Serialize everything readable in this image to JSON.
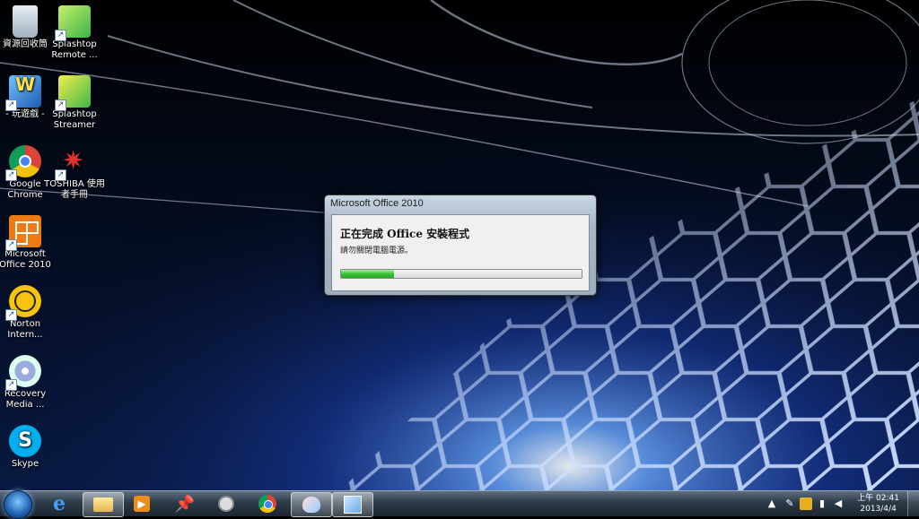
{
  "desktop": {
    "icons": [
      {
        "label": "資源回收筒",
        "icon": "recycle-bin-icon"
      },
      {
        "label": "Splashtop Remote ...",
        "icon": "splashtop-remote-icon"
      },
      {
        "label": "- 玩遊戲 -",
        "icon": "games-icon",
        "badge": "Games"
      },
      {
        "label": "Splashtop Streamer",
        "icon": "splashtop-streamer-icon"
      },
      {
        "label": "Google Chrome",
        "icon": "chrome-icon"
      },
      {
        "label": "TOSHIBA 使用者手冊",
        "icon": "toshiba-manual-icon"
      },
      {
        "label": "Microsoft Office 2010",
        "icon": "office-icon"
      },
      {
        "label": "Norton Intern...",
        "icon": "norton-icon"
      },
      {
        "label": "Recovery Media ...",
        "icon": "recovery-media-icon"
      },
      {
        "label": "Skype",
        "icon": "skype-icon"
      }
    ]
  },
  "dialog": {
    "title": "Microsoft Office 2010",
    "heading": "正在完成 Office 安裝程式",
    "subtext": "請勿關閉電腦電源。",
    "progress": 0.22
  },
  "taskbar": {
    "pinned": [
      {
        "icon": "start-orb-icon"
      },
      {
        "icon": "internet-explorer-icon"
      },
      {
        "icon": "windows-explorer-icon",
        "active": true
      },
      {
        "icon": "media-player-icon"
      },
      {
        "icon": "pin-icon"
      },
      {
        "icon": "clock-app-icon"
      },
      {
        "icon": "chrome-icon"
      },
      {
        "icon": "paint-icon",
        "active": true
      },
      {
        "icon": "office-setup-icon",
        "active": true
      }
    ],
    "clock": {
      "time": "上午 02:41",
      "date": "2013/4/4"
    }
  },
  "colors": {
    "accent": "#1f5fb0",
    "progress": "#37c437",
    "wallpaper_hex": "#2a5cd6"
  }
}
